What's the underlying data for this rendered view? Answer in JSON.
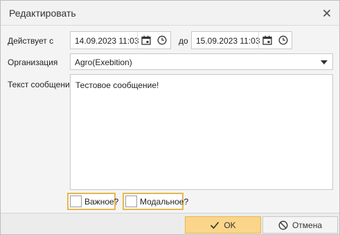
{
  "window": {
    "title": "Редактировать"
  },
  "form": {
    "valid_from_label": "Действует с",
    "valid_from_value": "14.09.2023 11:03",
    "to_label": "до",
    "valid_to_value": "15.09.2023 11:03",
    "org_label": "Организация",
    "org_value": "Agro(Exebition)",
    "message_label": "Текст сообщения",
    "message_value": "Тестовое сообщение!",
    "important_label": "Важное?",
    "modal_label": "Модальное?"
  },
  "buttons": {
    "ok_label": "OK",
    "cancel_label": "Отмена"
  },
  "icons": [
    "close-icon",
    "calendar-icon",
    "clock-icon",
    "chevron-down-icon",
    "checkmark-icon",
    "cancel-circle-icon"
  ],
  "colors": {
    "accent": "#fbd58a",
    "accent_border": "#e6b84c"
  }
}
